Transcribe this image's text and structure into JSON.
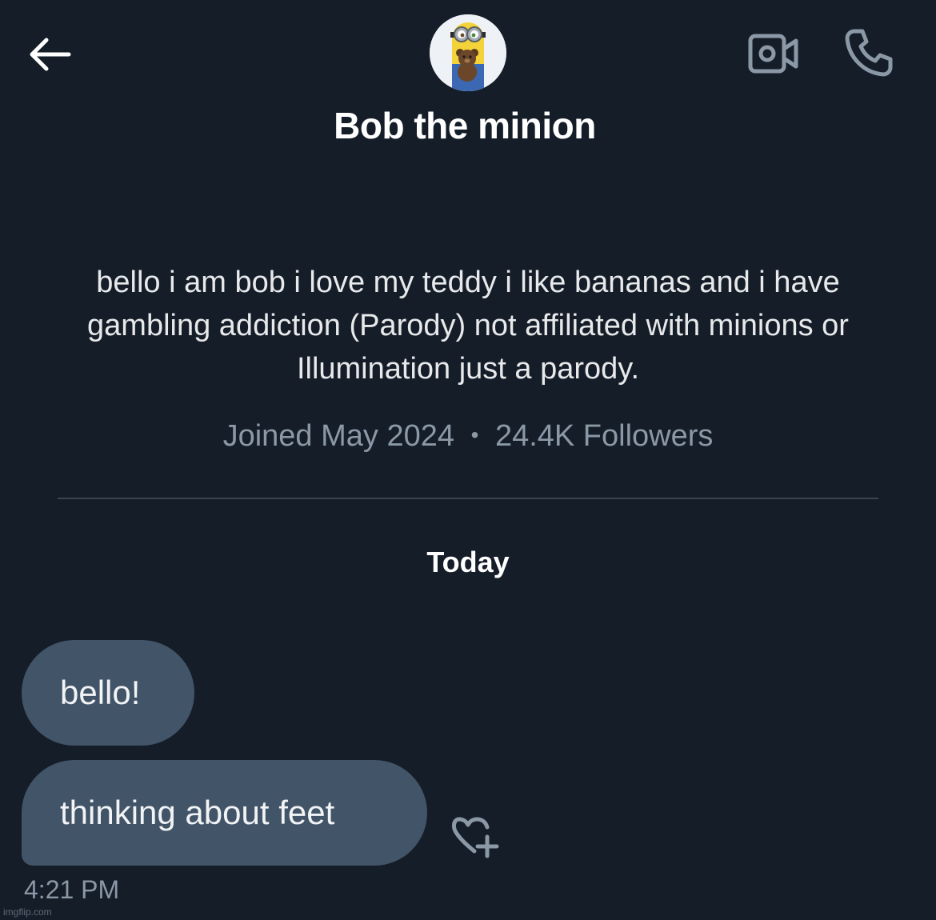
{
  "header": {
    "contact_name": "Bob the minion",
    "icons": {
      "back": "back-arrow-icon",
      "video": "video-call-icon",
      "phone": "phone-icon"
    }
  },
  "profile": {
    "bio": "bello i am bob i love my teddy i like bananas and i have gambling addiction (Parody) not affiliated with minions or Illumination just a parody.",
    "joined": "Joined May 2024",
    "separator": "•",
    "followers": "24.4K Followers"
  },
  "conversation": {
    "date_label": "Today",
    "messages": [
      {
        "text": "bello!"
      },
      {
        "text": "thinking about feet"
      }
    ],
    "timestamp": "4:21 PM"
  },
  "watermark": "imgflip.com",
  "colors": {
    "background": "#151d29",
    "bubble": "#425467",
    "muted_text": "#8b98a5",
    "icon": "#8b98a5"
  }
}
